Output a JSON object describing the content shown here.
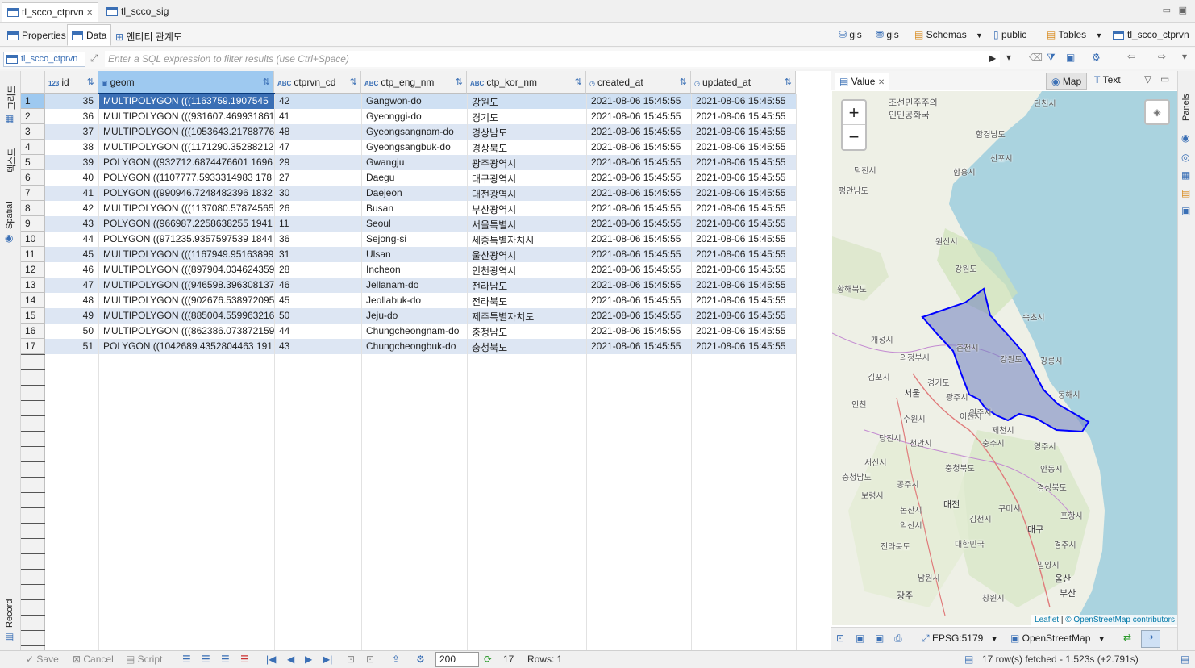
{
  "editor_tabs": [
    "tl_scco_ctprvn",
    "tl_scco_sig"
  ],
  "sub_tabs": [
    "Properties",
    "Data",
    "엔티티 관계도"
  ],
  "breadcrumb": {
    "connection": "gis",
    "database": "gis",
    "schemas": "Schemas",
    "schema": "public",
    "tables": "Tables",
    "table": "tl_scco_ctprvn"
  },
  "filter": {
    "source": "tl_scco_ctprvn",
    "placeholder": "Enter a SQL expression to filter results (use Ctrl+Space)"
  },
  "left_tools": [
    "그리드",
    "텍스트",
    "Spatial",
    "Record"
  ],
  "columns": [
    {
      "name": "id",
      "type": "123"
    },
    {
      "name": "geom",
      "type": "geom"
    },
    {
      "name": "ctprvn_cd",
      "type": "ABC"
    },
    {
      "name": "ctp_eng_nm",
      "type": "ABC"
    },
    {
      "name": "ctp_kor_nm",
      "type": "ABC"
    },
    {
      "name": "created_at",
      "type": "time"
    },
    {
      "name": "updated_at",
      "type": "time"
    }
  ],
  "rows": [
    [
      "1",
      "35",
      "MULTIPOLYGON (((1163759.1907545",
      "42",
      "Gangwon-do",
      "강원도",
      "2021-08-06 15:45:55",
      "2021-08-06 15:45:55"
    ],
    [
      "2",
      "36",
      "MULTIPOLYGON (((931607.469931861",
      "41",
      "Gyeonggi-do",
      "경기도",
      "2021-08-06 15:45:55",
      "2021-08-06 15:45:55"
    ],
    [
      "3",
      "37",
      "MULTIPOLYGON (((1053643.21788776",
      "48",
      "Gyeongsangnam-do",
      "경상남도",
      "2021-08-06 15:45:55",
      "2021-08-06 15:45:55"
    ],
    [
      "4",
      "38",
      "MULTIPOLYGON (((1171290.35288212",
      "47",
      "Gyeongsangbuk-do",
      "경상북도",
      "2021-08-06 15:45:55",
      "2021-08-06 15:45:55"
    ],
    [
      "5",
      "39",
      "POLYGON ((932712.6874476601 1696",
      "29",
      "Gwangju",
      "광주광역시",
      "2021-08-06 15:45:55",
      "2021-08-06 15:45:55"
    ],
    [
      "6",
      "40",
      "POLYGON ((1107777.5933314983 178",
      "27",
      "Daegu",
      "대구광역시",
      "2021-08-06 15:45:55",
      "2021-08-06 15:45:55"
    ],
    [
      "7",
      "41",
      "POLYGON ((990946.7248482396 1832",
      "30",
      "Daejeon",
      "대전광역시",
      "2021-08-06 15:45:55",
      "2021-08-06 15:45:55"
    ],
    [
      "8",
      "42",
      "MULTIPOLYGON (((1137080.57874565",
      "26",
      "Busan",
      "부산광역시",
      "2021-08-06 15:45:55",
      "2021-08-06 15:45:55"
    ],
    [
      "9",
      "43",
      "POLYGON ((966987.2258638255 1941",
      "11",
      "Seoul",
      "서울특별시",
      "2021-08-06 15:45:55",
      "2021-08-06 15:45:55"
    ],
    [
      "10",
      "44",
      "POLYGON ((971235.9357597539 1844",
      "36",
      "Sejong-si",
      "세종특별자치시",
      "2021-08-06 15:45:55",
      "2021-08-06 15:45:55"
    ],
    [
      "11",
      "45",
      "MULTIPOLYGON (((1167949.95163899",
      "31",
      "Ulsan",
      "울산광역시",
      "2021-08-06 15:45:55",
      "2021-08-06 15:45:55"
    ],
    [
      "12",
      "46",
      "MULTIPOLYGON (((897904.034624359",
      "28",
      "Incheon",
      "인천광역시",
      "2021-08-06 15:45:55",
      "2021-08-06 15:45:55"
    ],
    [
      "13",
      "47",
      "MULTIPOLYGON (((946598.396308137",
      "46",
      "Jellanam-do",
      "전라남도",
      "2021-08-06 15:45:55",
      "2021-08-06 15:45:55"
    ],
    [
      "14",
      "48",
      "MULTIPOLYGON (((902676.538972095",
      "45",
      "Jeollabuk-do",
      "전라북도",
      "2021-08-06 15:45:55",
      "2021-08-06 15:45:55"
    ],
    [
      "15",
      "49",
      "MULTIPOLYGON (((885004.559963216",
      "50",
      "Jeju-do",
      "제주특별자치도",
      "2021-08-06 15:45:55",
      "2021-08-06 15:45:55"
    ],
    [
      "16",
      "50",
      "MULTIPOLYGON (((862386.073872159",
      "44",
      "Chungcheongnam-do",
      "충청남도",
      "2021-08-06 15:45:55",
      "2021-08-06 15:45:55"
    ],
    [
      "17",
      "51",
      "POLYGON ((1042689.4352804463 191",
      "43",
      "Chungcheongbuk-do",
      "충청북도",
      "2021-08-06 15:45:55",
      "2021-08-06 15:45:55"
    ]
  ],
  "value_panel": {
    "tab": "Value",
    "map_btn": "Map",
    "text_btn": "Text",
    "panels": "Panels"
  },
  "map": {
    "labels": [
      "조선민주주의인민공화국",
      "함경남도",
      "단천시",
      "신포시",
      "함흥시",
      "덕천시",
      "평안남도",
      "원산시",
      "강원도",
      "황해북도",
      "개성시",
      "의정부시",
      "김포시",
      "서울",
      "경기도",
      "인천",
      "수원시",
      "광주시",
      "이천시",
      "원주시",
      "춘천시",
      "강원도",
      "강릉시",
      "속초시",
      "동해시",
      "제천시",
      "충주시",
      "영주시",
      "당진시",
      "천안시",
      "서산시",
      "충청남도",
      "충청북도",
      "안동시",
      "공주시",
      "경상북도",
      "보령시",
      "대전",
      "구미시",
      "논산시",
      "김천시",
      "포항시",
      "익산시",
      "대구",
      "경주시",
      "전라북도",
      "대한민국",
      "밀양시",
      "울산",
      "광주",
      "남원시",
      "창원시",
      "부산"
    ],
    "attribution_leaflet": "Leaflet",
    "attribution_osm": "© OpenStreetMap contributors",
    "zoom_in": "+",
    "zoom_out": "−"
  },
  "map_footer": {
    "crs": "EPSG:5179",
    "basemap": "OpenStreetMap"
  },
  "status": {
    "save": "Save",
    "cancel": "Cancel",
    "script": "Script",
    "page_size": "200",
    "count": "17",
    "rows": "Rows: 1",
    "fetched": "17 row(s) fetched - 1.523s (+2.791s)"
  },
  "colors": {
    "selection": "#9ec9f0",
    "row_alt": "#dde6f3",
    "polygon_stroke": "#0000ff",
    "polygon_fill": "#6f7fc0"
  }
}
